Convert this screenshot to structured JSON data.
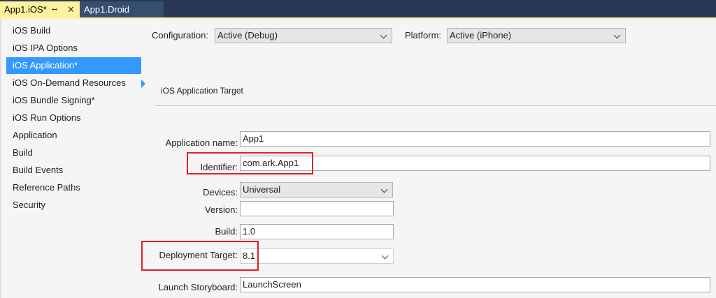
{
  "tabs": {
    "active_label": "App1.iOS*",
    "pin_icon": "pin-icon",
    "close_icon": "close-icon",
    "inactive_label": "App1.Droid"
  },
  "sidebar": {
    "items": [
      {
        "label": "iOS Build"
      },
      {
        "label": "iOS IPA Options"
      },
      {
        "label": "iOS Application*",
        "selected": true
      },
      {
        "label": "iOS On-Demand Resources"
      },
      {
        "label": "iOS Bundle Signing*"
      },
      {
        "label": "iOS Run Options"
      },
      {
        "label": "Application"
      },
      {
        "label": "Build"
      },
      {
        "label": "Build Events"
      },
      {
        "label": "Reference Paths"
      },
      {
        "label": "Security"
      }
    ]
  },
  "toolbar": {
    "configuration_label": "Configuration:",
    "configuration_value": "Active (Debug)",
    "platform_label": "Platform:",
    "platform_value": "Active (iPhone)"
  },
  "section": {
    "title": "iOS Application Target"
  },
  "form": {
    "app_name_label": "Application name:",
    "app_name_value": "App1",
    "identifier_label": "Identifier:",
    "identifier_value": "com.ark.App1",
    "devices_label": "Devices:",
    "devices_value": "Universal",
    "version_label": "Version:",
    "version_value": "",
    "build_label": "Build:",
    "build_value": "1.0",
    "deployment_label": "Deployment Target:",
    "deployment_value": "8.1",
    "storyboard_label": "Launch Storyboard:",
    "storyboard_value": "LaunchScreen"
  },
  "colors": {
    "tab_active": "#fff29d",
    "tab_bar": "#293955",
    "selection": "#3399ff",
    "highlight": "#e41e26"
  }
}
